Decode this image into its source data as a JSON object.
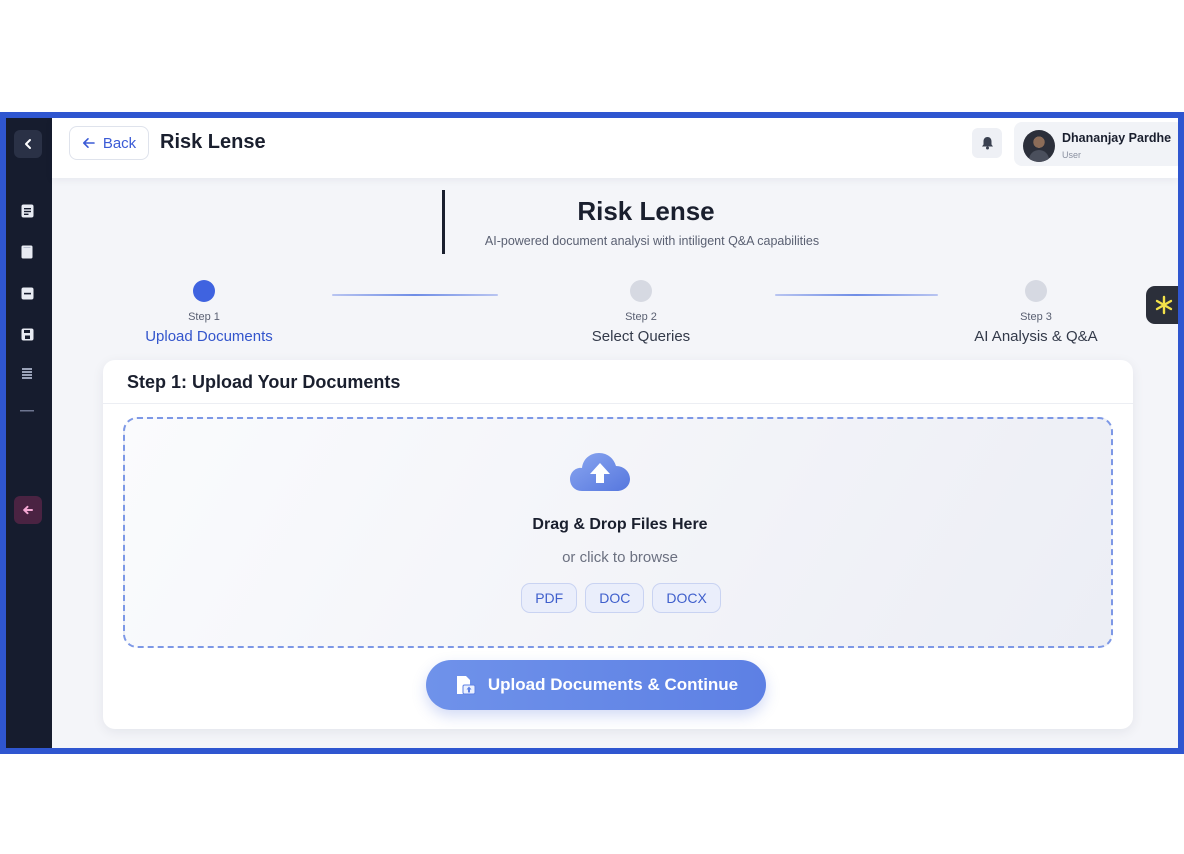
{
  "colors": {
    "frame": "#2f56d0",
    "sidebar": "#161c2e",
    "accent": "#3f63e0",
    "cta": "#6f92ea"
  },
  "sidebar": {
    "collapse_icon": "chevron-left-icon",
    "items": [
      {
        "icon": "document-icon"
      },
      {
        "icon": "file-icon"
      },
      {
        "icon": "minus-box-icon"
      },
      {
        "icon": "save-icon"
      },
      {
        "icon": "list-icon"
      },
      {
        "icon": "dash-icon"
      }
    ],
    "exit_icon": "arrow-left-icon"
  },
  "header": {
    "back_label": "Back",
    "title": "Risk Lense",
    "notification_icon": "bell-icon",
    "user": {
      "name": "Dhananjay Pardhe",
      "role": "User"
    }
  },
  "intro": {
    "title": "Risk Lense",
    "subtitle": "AI-powered document analysi with intiligent Q&A capabilities"
  },
  "steps": [
    {
      "number": "Step 1",
      "label": "Upload Documents",
      "state": "active"
    },
    {
      "number": "Step 2",
      "label": "Select Queries",
      "state": "pending"
    },
    {
      "number": "Step 3",
      "label": "AI Analysis & Q&A",
      "state": "pending"
    }
  ],
  "upload_card": {
    "title": "Step 1: Upload Your Documents",
    "drop_title": "Drag & Drop Files Here",
    "drop_subtitle": "or click to browse",
    "file_types": [
      "PDF",
      "DOC",
      "DOCX"
    ],
    "cta_label": "Upload Documents & Continue"
  },
  "assistant_icon": "asterisk-icon"
}
